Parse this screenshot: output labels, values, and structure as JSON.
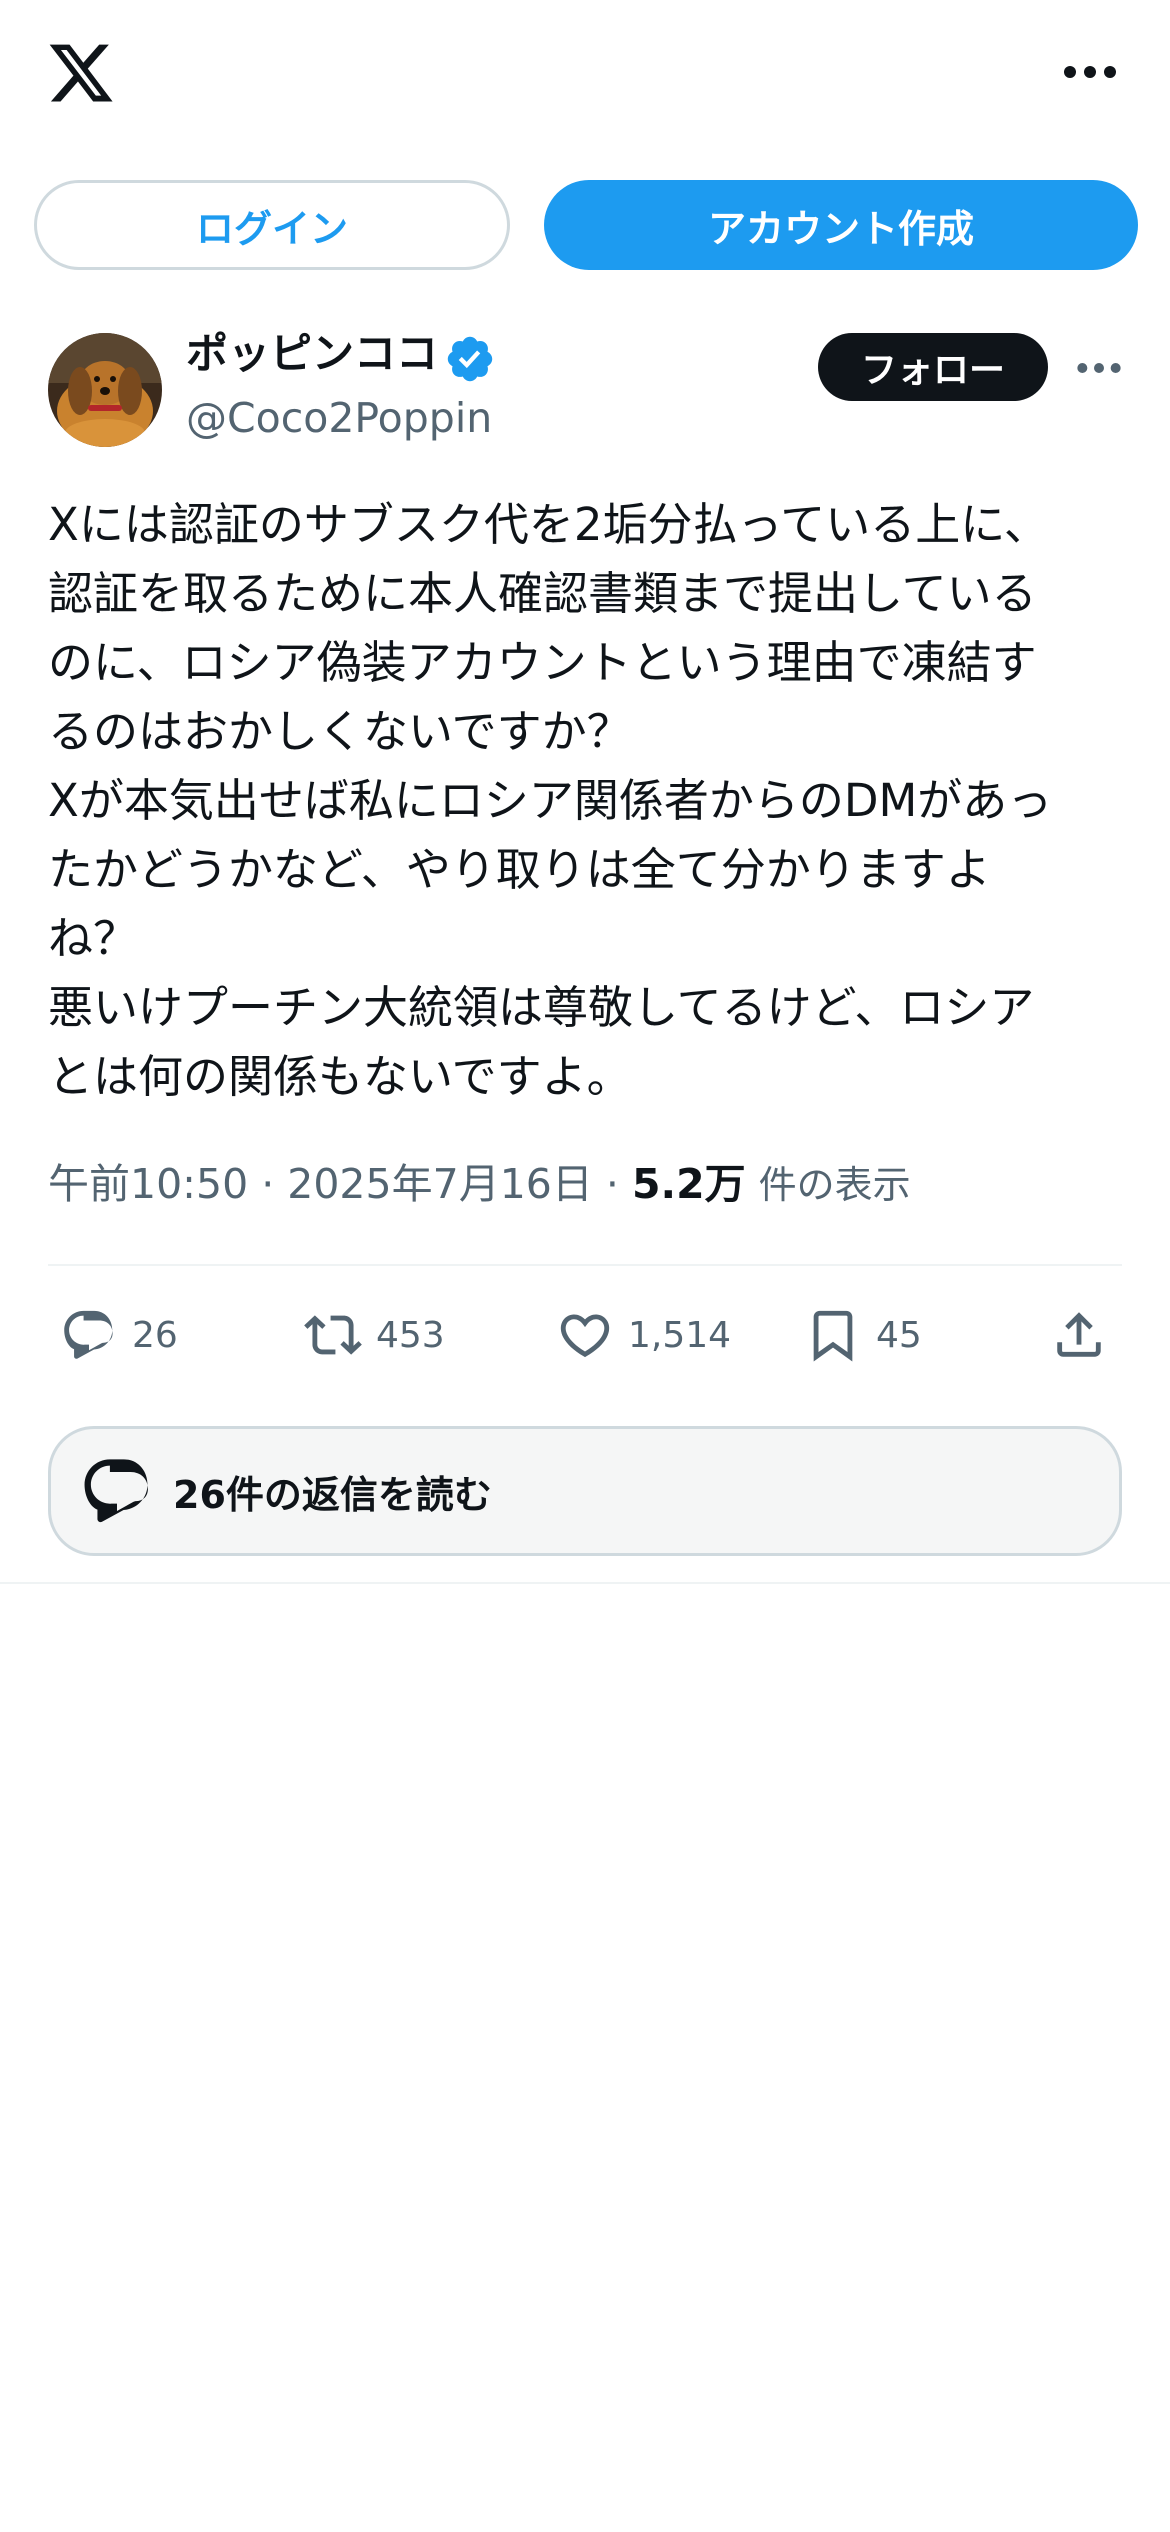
{
  "header": {
    "logo_icon": "x-logo-icon",
    "more_icon": "more-horizontal-icon"
  },
  "auth": {
    "login_label": "ログイン",
    "signup_label": "アカウント作成"
  },
  "post": {
    "author": {
      "display_name": "ポッピンココ",
      "handle": "@Coco2Poppin",
      "verified": true
    },
    "follow_label": "フォロー",
    "body_lines": [
      "Xには認証のサブスク代を2垢分払っている上に、",
      "認証を取るために本人確認書類まで提出している",
      "のに、ロシア偽装アカウントという理由で凍結す",
      "るのはおかしくないですか？",
      "Xが本気出せば私にロシア関係者からのDMがあっ",
      "たかどうかなど、やり取りは全て分かりますよ",
      "ね？",
      "悪いけプーチン大統領は尊敬してるけど、ロシア",
      "とは何の関係もないですよ。"
    ],
    "time": "午前10:50",
    "separator": " · ",
    "date": "2025年7月16日",
    "views_count": "5.2万",
    "views_label": "件の表示",
    "actions": {
      "reply_count": "26",
      "retweet_count": "453",
      "like_count": "1,514",
      "bookmark_count": "45"
    },
    "read_replies_label": "26件の返信を読む"
  },
  "colors": {
    "accent": "#1d9bf0",
    "text": "#0f1419",
    "secondary": "#536471",
    "border": "#cfd9de"
  }
}
